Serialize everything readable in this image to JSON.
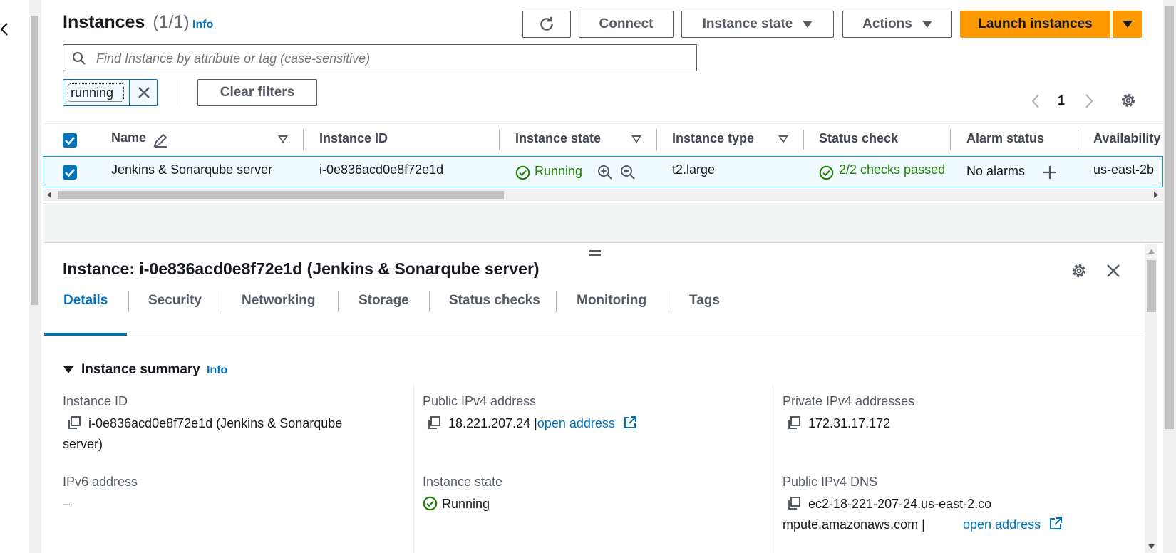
{
  "left_nav": {
    "collapse_icon": "chevron-left-icon"
  },
  "header": {
    "title": "Instances",
    "count": "(1/1)",
    "info_label": "Info",
    "refresh_icon": "refresh-icon",
    "connect_label": "Connect",
    "instance_state_label": "Instance state",
    "actions_label": "Actions",
    "launch_label": "Launch instances"
  },
  "search": {
    "placeholder": "Find Instance by attribute or tag (case-sensitive)",
    "value": ""
  },
  "filter_token": {
    "value": "running"
  },
  "clear_filters_label": "Clear filters",
  "pagination": {
    "current_page": "1"
  },
  "table": {
    "columns": [
      "Name",
      "Instance ID",
      "Instance state",
      "Instance type",
      "Status check",
      "Alarm status",
      "Availability"
    ],
    "rows": [
      {
        "name": "Jenkins & Sonarqube server",
        "instance_id": "i-0e836acd0e8f72e1d",
        "state": "Running",
        "type": "t2.large",
        "status_check": "2/2 checks passed",
        "alarm_status": "No alarms",
        "availability_zone": "us-east-2b",
        "selected": true
      }
    ]
  },
  "details": {
    "title": "Instance: i-0e836acd0e8f72e1d (Jenkins & Sonarqube server)",
    "tabs": [
      "Details",
      "Security",
      "Networking",
      "Storage",
      "Status checks",
      "Monitoring",
      "Tags"
    ],
    "active_tab": "Details",
    "summary_title": "Instance summary",
    "summary_info": "Info",
    "fields": {
      "instance_id": {
        "label": "Instance ID",
        "value": "i-0e836acd0e8f72e1d (Jenkins & Sonarqube server)"
      },
      "public_ipv4": {
        "label": "Public IPv4 address",
        "value": "18.221.207.24 |",
        "link": "open address"
      },
      "private_ipv4": {
        "label": "Private IPv4 addresses",
        "value": "172.31.17.172"
      },
      "ipv6": {
        "label": "IPv6 address",
        "value": "–"
      },
      "instance_state": {
        "label": "Instance state",
        "value": "Running"
      },
      "public_dns": {
        "label": "Public IPv4 DNS",
        "value": "ec2-18-221-207-24.us-east-2.compute.amazonaws.com |",
        "link": "open address"
      }
    }
  },
  "colors": {
    "accent": "#ff9900",
    "link": "#0073bb",
    "success": "#1d8102",
    "selected_row": "#f1faff"
  }
}
